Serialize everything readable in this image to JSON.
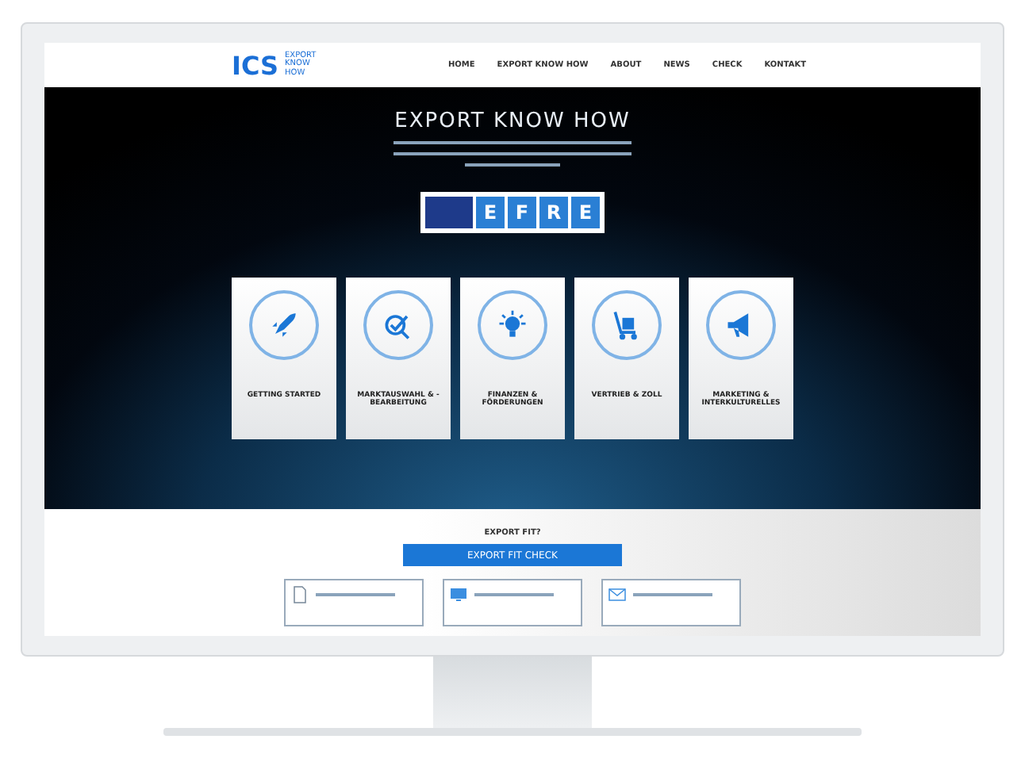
{
  "logo": {
    "mark": "ICS",
    "tagline": "EXPORT KNOW HOW"
  },
  "nav": [
    "HOME",
    "EXPORT KNOW HOW",
    "ABOUT",
    "NEWS",
    "CHECK",
    "KONTAKT"
  ],
  "hero": {
    "title": "EXPORT KNOW HOW",
    "badge": [
      "E",
      "F",
      "R",
      "E"
    ]
  },
  "cards": [
    {
      "label": "GETTING STARTED",
      "kind": "rocket"
    },
    {
      "label": "MARKTAUSWAHL & -BEARBEITUNG",
      "kind": "target"
    },
    {
      "label": "FINANZEN & FÖRDERUNGEN",
      "kind": "bulb"
    },
    {
      "label": "VERTRIEB & ZOLL",
      "kind": "cart"
    },
    {
      "label": "MARKETING & INTERKULTURELLES",
      "kind": "megaphone"
    }
  ],
  "cta": {
    "heading": "EXPORT FIT?",
    "button": "EXPORT FIT CHECK"
  },
  "info_boxes": [
    {
      "kind": "doc"
    },
    {
      "kind": "screen"
    },
    {
      "kind": "mail"
    }
  ]
}
